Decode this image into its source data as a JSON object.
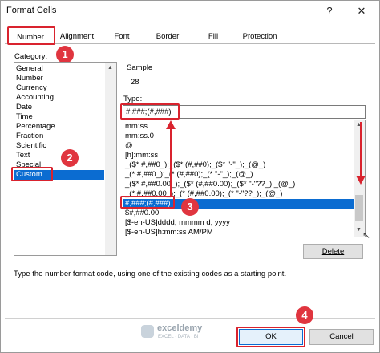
{
  "window": {
    "title": "Format Cells",
    "help": "?",
    "close": "✕"
  },
  "tabs": [
    "Number",
    "Alignment",
    "Font",
    "Border",
    "Fill",
    "Protection"
  ],
  "category": {
    "label": "Category:",
    "items": [
      "General",
      "Number",
      "Currency",
      "Accounting",
      "Date",
      "Time",
      "Percentage",
      "Fraction",
      "Scientific",
      "Text",
      "Special",
      "Custom"
    ],
    "selected": "Custom"
  },
  "sample": {
    "label": "Sample",
    "value": "28"
  },
  "type": {
    "label": "Type:",
    "value": "#,###;(#,###)",
    "list": [
      "mm:ss",
      "mm:ss.0",
      "@",
      "[h]:mm:ss",
      "_($* #,##0_);_($* (#,##0);_($* \"-\"_);_(@_)",
      "_(* #,##0_);_(* (#,##0);_(* \"-\"_);_(@_)",
      "_($* #,##0.00_);_($* (#,##0.00);_($* \"-\"??_);_(@_)",
      "_(* #,##0.00_);_(* (#,##0.00);_(* \"-\"??_);_(@_)",
      "#,###;(#,###)",
      "$#,##0.00",
      "[$-en-US]dddd, mmmm d, yyyy",
      "[$-en-US]h:mm:ss AM/PM"
    ],
    "selected": "#,###;(#,###)"
  },
  "buttons": {
    "delete": "Delete",
    "ok": "OK",
    "cancel": "Cancel"
  },
  "description": "Type the number format code, using one of the existing codes as a starting point.",
  "watermark": {
    "name": "exceldemy",
    "tagline": "EXCEL · DATA · BI"
  },
  "steps": [
    "1",
    "2",
    "3",
    "4"
  ],
  "colors": {
    "annotation_red": "#d9232e",
    "selection_blue": "#0b6cd1"
  }
}
